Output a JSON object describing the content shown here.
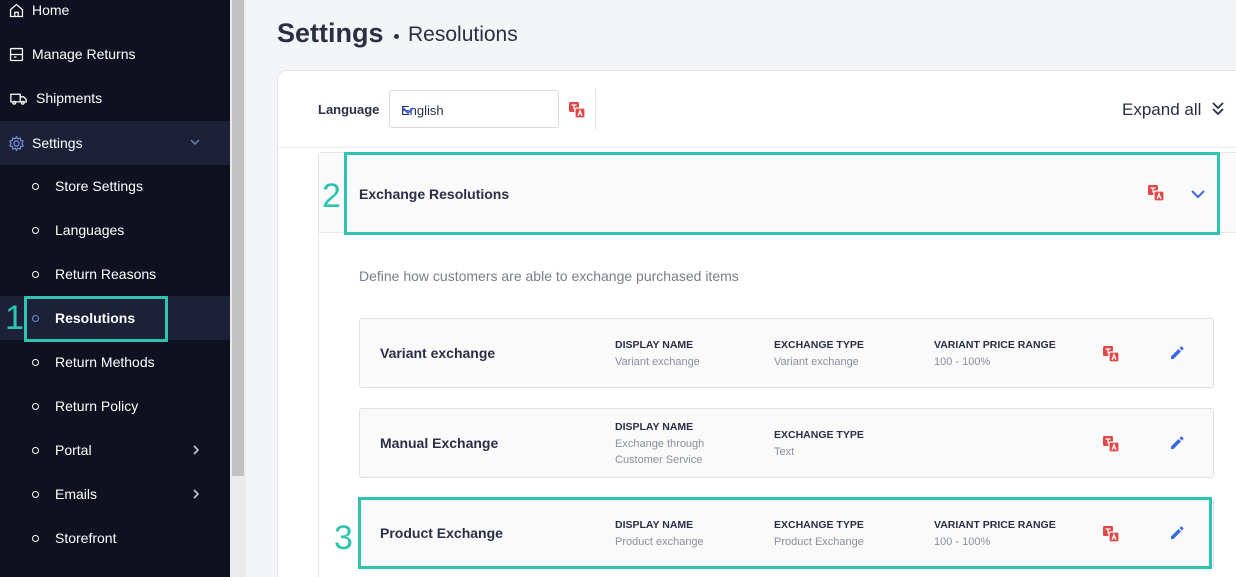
{
  "sidebar": {
    "items": [
      {
        "label": "Home",
        "icon": "home-icon"
      },
      {
        "label": "Manage Returns",
        "icon": "returns-icon"
      },
      {
        "label": "Shipments",
        "icon": "truck-icon"
      },
      {
        "label": "Settings",
        "icon": "gear-icon"
      }
    ],
    "sub_items": [
      {
        "label": "Store Settings"
      },
      {
        "label": "Languages"
      },
      {
        "label": "Return Reasons"
      },
      {
        "label": "Resolutions"
      },
      {
        "label": "Return Methods"
      },
      {
        "label": "Return Policy"
      },
      {
        "label": "Portal"
      },
      {
        "label": "Emails"
      },
      {
        "label": "Storefront"
      }
    ]
  },
  "header": {
    "title": "Settings",
    "subtitle": "Resolutions"
  },
  "toolbar": {
    "language_label": "Language",
    "language_value": "English",
    "expand_all": "Expand all"
  },
  "section": {
    "title": "Exchange Resolutions",
    "description": "Define how customers are able to exchange purchased items",
    "rows": [
      {
        "title": "Variant exchange",
        "display_name_label": "DISPLAY NAME",
        "display_name": "Variant exchange",
        "exchange_type_label": "EXCHANGE TYPE",
        "exchange_type": "Variant exchange",
        "price_range_label": "VARIANT PRICE RANGE",
        "price_range": "100 - 100%"
      },
      {
        "title": "Manual Exchange",
        "display_name_label": "DISPLAY NAME",
        "display_name_1": "Exchange through",
        "display_name_2": "Customer Service",
        "exchange_type_label": "EXCHANGE TYPE",
        "exchange_type": "Text"
      },
      {
        "title": "Product Exchange",
        "display_name_label": "DISPLAY NAME",
        "display_name": "Product exchange",
        "exchange_type_label": "EXCHANGE TYPE",
        "exchange_type": "Product Exchange",
        "price_range_label": "VARIANT PRICE RANGE",
        "price_range": "100 - 100%"
      }
    ]
  },
  "annotations": [
    "1",
    "2",
    "3"
  ],
  "colors": {
    "annotation": "#2ec4b0",
    "accent": "#3b68e0",
    "translate": "#e04848",
    "sidebar_bg": "#0f1020"
  }
}
